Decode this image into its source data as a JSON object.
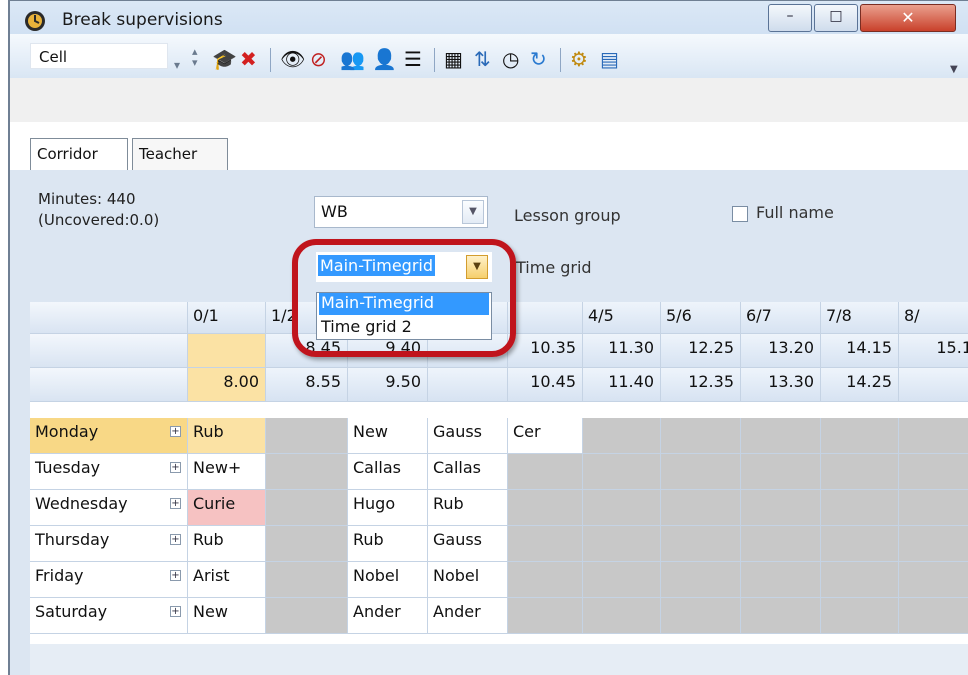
{
  "window": {
    "title": "Break supervisions",
    "controls": {
      "minimize": "–",
      "maximize": "□",
      "close": "✕"
    }
  },
  "toolbar": {
    "mode_value": "Cell",
    "icons": [
      "spin-icon",
      "graduate-cap-icon",
      "delete-icon",
      "eye-icon",
      "eye-crossed-icon",
      "assign-teacher-icon",
      "teachers-icon",
      "list-icon",
      "calculator-icon",
      "transfer-icon",
      "clock-icon",
      "refresh-icon",
      "settings-gear-icon",
      "calendar-view-icon"
    ]
  },
  "tabs": [
    {
      "label": "Corridor",
      "active": true
    },
    {
      "label": "Teacher",
      "active": false
    }
  ],
  "summary": {
    "minutes": "Minutes: 440",
    "uncovered": "(Uncovered:0.0)"
  },
  "lesson_group": {
    "value": "WB",
    "label": "Lesson group"
  },
  "full_name": {
    "label": "Full name",
    "checked": false
  },
  "time_grid": {
    "value": "Main-Timegrid",
    "label": "Time grid",
    "options": [
      "Main-Timegrid",
      "Time grid 2"
    ],
    "selected_index": 0
  },
  "grid": {
    "columns": [
      "0/1",
      "1/2",
      "",
      "",
      "",
      "4/5",
      "5/6",
      "6/7",
      "7/8",
      "8/"
    ],
    "start_times": [
      "",
      "8.45",
      "9.40",
      "",
      "10.35",
      "11.30",
      "12.25",
      "13.20",
      "14.15",
      "15.1"
    ],
    "end_times": [
      "8.00",
      "8.55",
      "9.50",
      "",
      "10.45",
      "11.40",
      "12.35",
      "13.30",
      "14.25",
      ""
    ],
    "rows": [
      {
        "day": "Monday",
        "cells": [
          "Rub",
          "",
          "New",
          "Gauss",
          "Cer",
          "",
          "",
          "",
          "",
          ""
        ]
      },
      {
        "day": "Tuesday",
        "cells": [
          "New+",
          "",
          "Callas",
          "Callas",
          "",
          "",
          "",
          "",
          "",
          ""
        ]
      },
      {
        "day": "Wednesday",
        "cells": [
          "Curie",
          "",
          "Hugo",
          "Rub",
          "",
          "",
          "",
          "",
          "",
          ""
        ]
      },
      {
        "day": "Thursday",
        "cells": [
          "Rub",
          "",
          "Rub",
          "Gauss",
          "",
          "",
          "",
          "",
          "",
          ""
        ]
      },
      {
        "day": "Friday",
        "cells": [
          "Arist",
          "",
          "Nobel",
          "Nobel",
          "",
          "",
          "",
          "",
          "",
          ""
        ]
      },
      {
        "day": "Saturday",
        "cells": [
          "New",
          "",
          "Ander",
          "Ander",
          "",
          "",
          "",
          "",
          "",
          ""
        ]
      }
    ]
  },
  "colors": {
    "accent_highlight": "#c0141c",
    "selection": "#3399ff",
    "active_day": "#f8d886",
    "conflict": "#f6c2c2",
    "blocked": "#c8c8c8"
  }
}
